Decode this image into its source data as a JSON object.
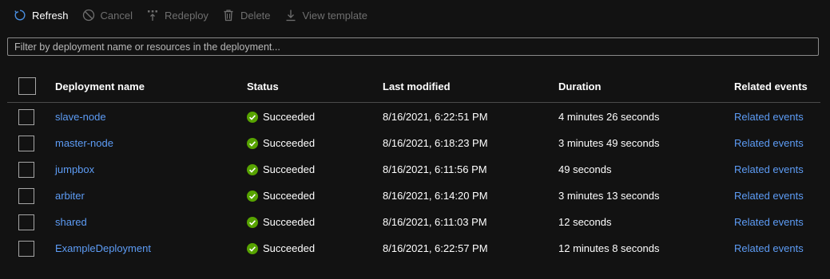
{
  "toolbar": {
    "refresh": "Refresh",
    "cancel": "Cancel",
    "redeploy": "Redeploy",
    "delete": "Delete",
    "view_template": "View template"
  },
  "filter": {
    "placeholder": "Filter by deployment name or resources in the deployment...",
    "value": ""
  },
  "table": {
    "headers": {
      "name": "Deployment name",
      "status": "Status",
      "modified": "Last modified",
      "duration": "Duration",
      "related": "Related events"
    },
    "rows": [
      {
        "name": "slave-node",
        "status": "Succeeded",
        "modified": "8/16/2021, 6:22:51 PM",
        "duration": "4 minutes 26 seconds",
        "related": "Related events"
      },
      {
        "name": "master-node",
        "status": "Succeeded",
        "modified": "8/16/2021, 6:18:23 PM",
        "duration": "3 minutes 49 seconds",
        "related": "Related events"
      },
      {
        "name": "jumpbox",
        "status": "Succeeded",
        "modified": "8/16/2021, 6:11:56 PM",
        "duration": "49 seconds",
        "related": "Related events"
      },
      {
        "name": "arbiter",
        "status": "Succeeded",
        "modified": "8/16/2021, 6:14:20 PM",
        "duration": "3 minutes 13 seconds",
        "related": "Related events"
      },
      {
        "name": "shared",
        "status": "Succeeded",
        "modified": "8/16/2021, 6:11:03 PM",
        "duration": "12 seconds",
        "related": "Related events"
      },
      {
        "name": "ExampleDeployment",
        "status": "Succeeded",
        "modified": "8/16/2021, 6:22:57 PM",
        "duration": "12 minutes 8 seconds",
        "related": "Related events"
      }
    ]
  },
  "colors": {
    "background": "#121212",
    "link": "#5d9cf5",
    "success": "#57a300",
    "accent": "#4a90e2",
    "disabled": "#6f6f6f"
  },
  "icons": {
    "refresh": "refresh-icon",
    "cancel": "cancel-icon",
    "redeploy": "redeploy-icon",
    "delete": "delete-icon",
    "view_template": "download-icon",
    "status": "success-check-icon"
  }
}
